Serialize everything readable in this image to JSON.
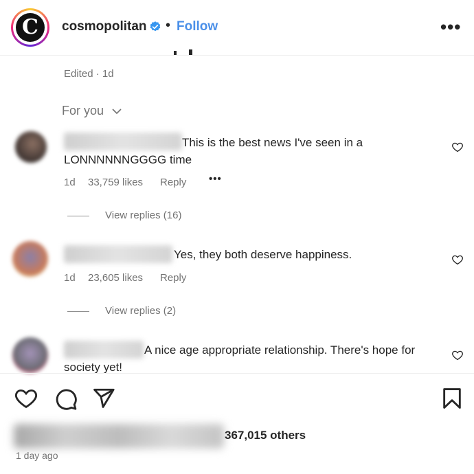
{
  "header": {
    "username": "cosmopolitan",
    "logo_letter": "C",
    "separator": "•",
    "follow_label": "Follow",
    "more_label": "•••"
  },
  "caption": {
    "edited_label": "Edited · 1d"
  },
  "comments_filter": {
    "label": "For you"
  },
  "comments": [
    {
      "text": "This is the best news I've seen in a LONNNNNNGGGG time",
      "time": "1d",
      "likes": "33,759 likes",
      "reply_label": "Reply",
      "more_label": "•••",
      "view_replies": "View replies (16)"
    },
    {
      "text": "Yes, they both deserve happiness.",
      "time": "1d",
      "likes": "23,605 likes",
      "reply_label": "Reply",
      "view_replies": "View replies (2)"
    },
    {
      "text": "A nice age appropriate relationship. There's hope for society yet!"
    }
  ],
  "footer": {
    "likes_others": "367,015 others",
    "timestamp": "1 day ago"
  },
  "colors": {
    "follow_blue": "#4a8fe8",
    "verified_blue": "#3897f0",
    "text_primary": "#262626",
    "text_secondary": "#737373"
  }
}
